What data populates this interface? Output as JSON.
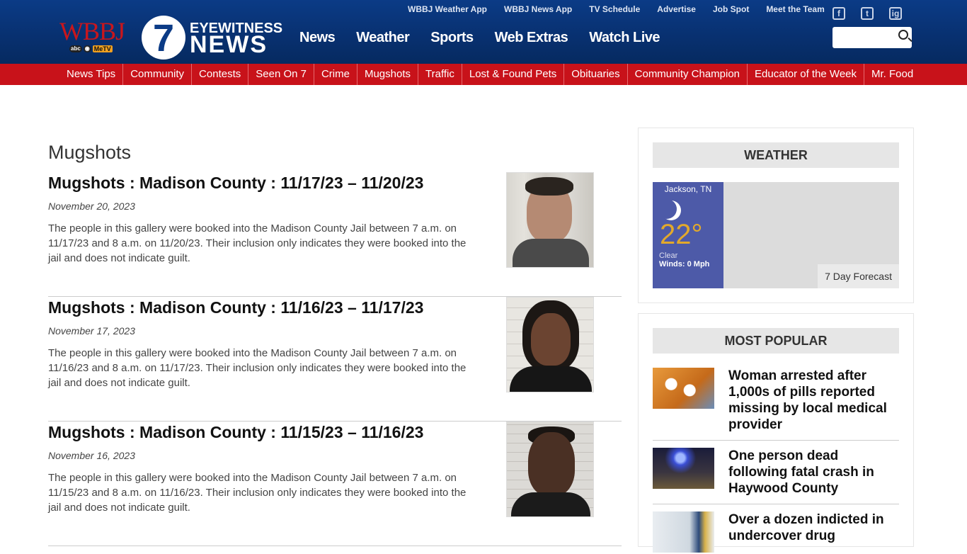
{
  "header": {
    "logo_wbbj": "WBBJ",
    "logo_sub": [
      "abc",
      "◉",
      "MeTV"
    ],
    "logo_seven": "7",
    "logo_eyewitness": "EYEWITNESS",
    "logo_news": "NEWS",
    "top_links": [
      "WBBJ Weather App",
      "WBBJ News App",
      "TV Schedule",
      "Advertise",
      "Job Spot",
      "Meet the Team"
    ],
    "main_nav": [
      "News",
      "Weather",
      "Sports",
      "Web Extras",
      "Watch Live"
    ],
    "social": [
      "f",
      "t",
      "ig"
    ],
    "search_placeholder": ""
  },
  "subnav": [
    "News Tips",
    "Community",
    "Contests",
    "Seen On 7",
    "Crime",
    "Mugshots",
    "Traffic",
    "Lost & Found Pets",
    "Obituaries",
    "Community Champion",
    "Educator of the Week",
    "Mr. Food"
  ],
  "main": {
    "page_title": "Mugshots",
    "articles": [
      {
        "title": "Mugshots : Madison County : 11/17/23 – 11/20/23",
        "date": "November 20, 2023",
        "desc": "The people in this gallery were booked into the Madison County Jail between 7 a.m. on 11/17/23 and 8 a.m. on 11/20/23. Their inclusion only indicates they were booked into the jail and does not indicate guilt."
      },
      {
        "title": "Mugshots : Madison County : 11/16/23 – 11/17/23",
        "date": "November 17, 2023",
        "desc": "The people in this gallery were booked into the Madison County Jail between 7 a.m. on 11/16/23 and 8 a.m. on 11/17/23. Their inclusion only indicates they were booked into the jail and does not indicate guilt."
      },
      {
        "title": "Mugshots : Madison County : 11/15/23 – 11/16/23",
        "date": "November 16, 2023",
        "desc": "The people in this gallery were booked into the Madison County Jail between 7 a.m. on 11/15/23 and 8 a.m. on 11/16/23. Their inclusion only indicates they were booked into the jail and does not indicate guilt."
      }
    ]
  },
  "sidebar": {
    "weather": {
      "title": "WEATHER",
      "city": "Jackson, TN",
      "temp": "22°",
      "condition": "Clear",
      "wind": "Winds: 0 Mph",
      "forecast_button": "7 Day Forecast"
    },
    "popular": {
      "title": "MOST POPULAR",
      "items": [
        "Woman arrested after 1,000s of pills reported missing by local medical provider",
        "One person dead following fatal crash in Haywood County",
        "Over a dozen indicted in undercover drug"
      ]
    }
  },
  "colors": {
    "header_blue": "#0b3b86",
    "subnav_red": "#c8121a",
    "weather_panel": "#4d5aa8",
    "temp_gold": "#e2a92b"
  }
}
